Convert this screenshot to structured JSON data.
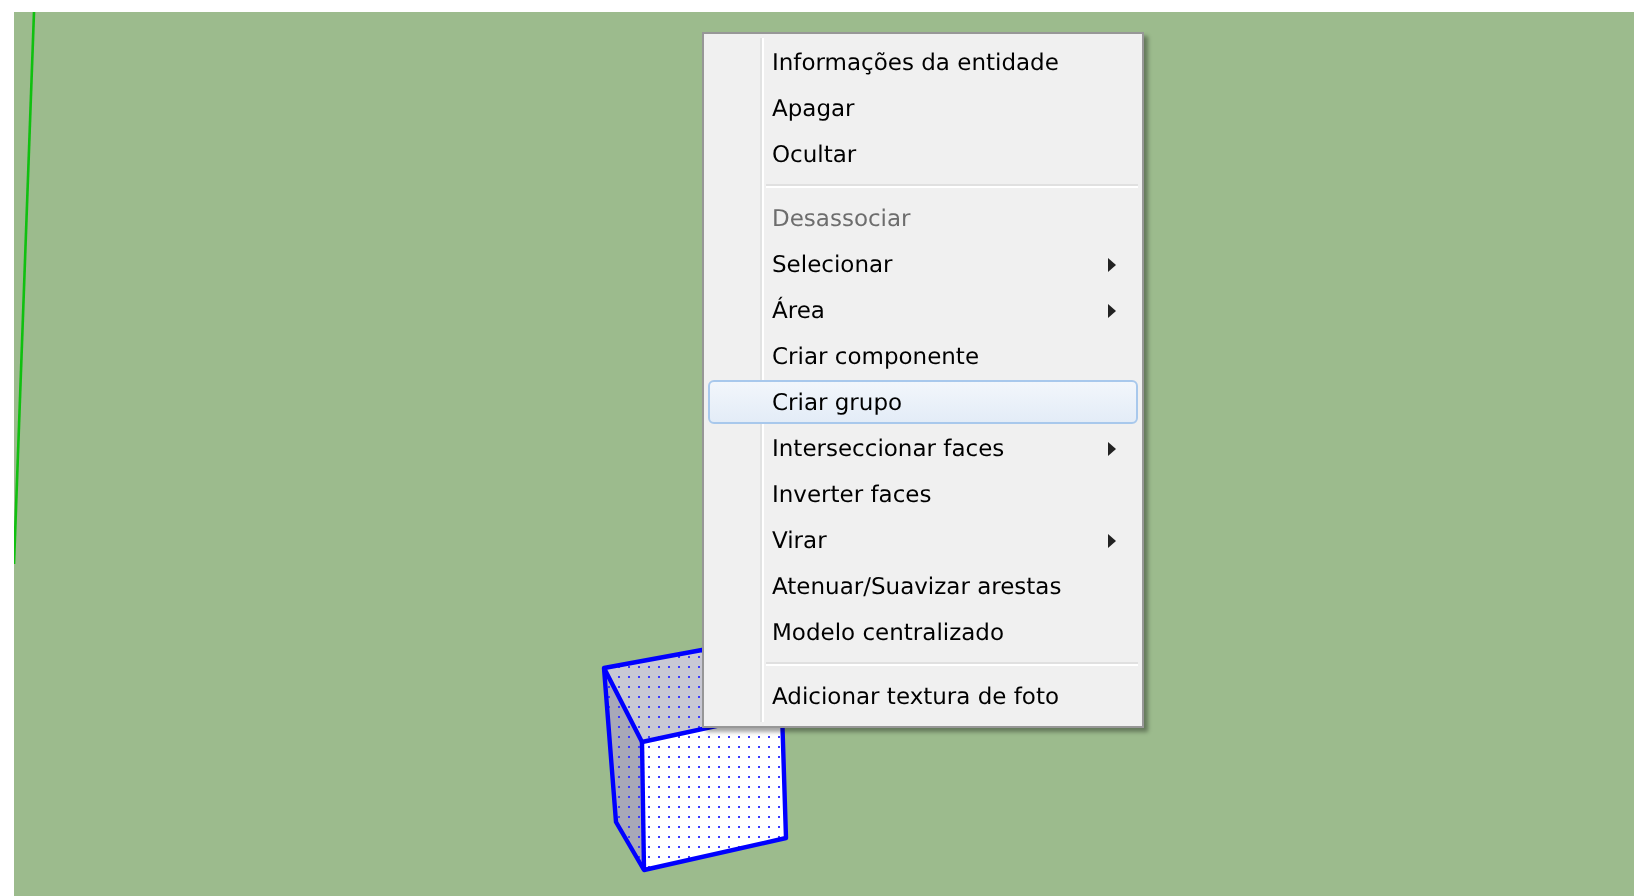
{
  "context_menu": {
    "items": [
      {
        "kind": "item",
        "label": "Informações da entidade",
        "disabled": false,
        "submenu": false,
        "selected": false
      },
      {
        "kind": "item",
        "label": "Apagar",
        "disabled": false,
        "submenu": false,
        "selected": false
      },
      {
        "kind": "item",
        "label": "Ocultar",
        "disabled": false,
        "submenu": false,
        "selected": false
      },
      {
        "kind": "separator"
      },
      {
        "kind": "item",
        "label": "Desassociar",
        "disabled": true,
        "submenu": false,
        "selected": false
      },
      {
        "kind": "item",
        "label": "Selecionar",
        "disabled": false,
        "submenu": true,
        "selected": false
      },
      {
        "kind": "item",
        "label": "Área",
        "disabled": false,
        "submenu": true,
        "selected": false
      },
      {
        "kind": "item",
        "label": "Criar componente",
        "disabled": false,
        "submenu": false,
        "selected": false
      },
      {
        "kind": "item",
        "label": "Criar grupo",
        "disabled": false,
        "submenu": false,
        "selected": true
      },
      {
        "kind": "item",
        "label": "Interseccionar faces",
        "disabled": false,
        "submenu": true,
        "selected": false
      },
      {
        "kind": "item",
        "label": "Inverter faces",
        "disabled": false,
        "submenu": false,
        "selected": false
      },
      {
        "kind": "item",
        "label": "Virar",
        "disabled": false,
        "submenu": true,
        "selected": false
      },
      {
        "kind": "item",
        "label": "Atenuar/Suavizar arestas",
        "disabled": false,
        "submenu": false,
        "selected": false
      },
      {
        "kind": "item",
        "label": "Modelo centralizado",
        "disabled": false,
        "submenu": false,
        "selected": false
      },
      {
        "kind": "separator"
      },
      {
        "kind": "item",
        "label": "Adicionar textura de foto",
        "disabled": false,
        "submenu": false,
        "selected": false
      }
    ]
  }
}
